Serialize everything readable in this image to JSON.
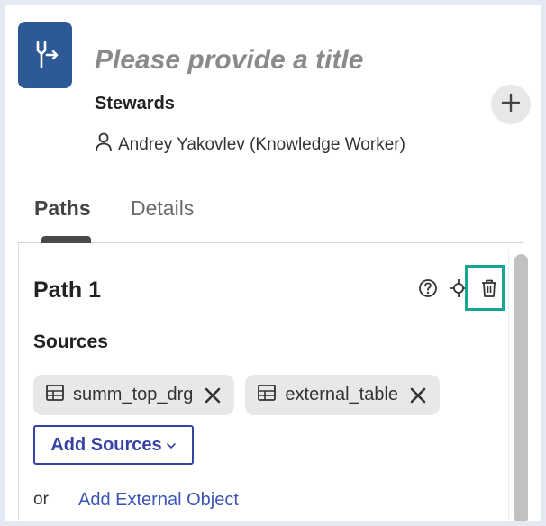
{
  "header": {
    "app_icon": "merge-path-icon",
    "title_placeholder": "Please provide a title",
    "stewards_label": "Stewards",
    "steward_name": "Andrey Yakovlev (Knowledge Worker)",
    "add_icon": "plus-icon"
  },
  "tabs": [
    {
      "label": "Paths",
      "active": true
    },
    {
      "label": "Details",
      "active": false
    }
  ],
  "path": {
    "title": "Path 1",
    "icons": [
      "help-icon",
      "move-icon",
      "trash-icon"
    ],
    "sources_label": "Sources",
    "sources": [
      {
        "label": "summ_top_drg",
        "icon": "table-icon"
      },
      {
        "label": "external_table",
        "icon": "table-icon"
      }
    ],
    "add_sources_label": "Add Sources",
    "or_label": "or",
    "add_external_label": "Add External Object"
  },
  "colors": {
    "app_icon_bg": "#2d5a96",
    "highlight": "#15a68c",
    "link": "#3d55b3",
    "button_border": "#3742a6"
  }
}
